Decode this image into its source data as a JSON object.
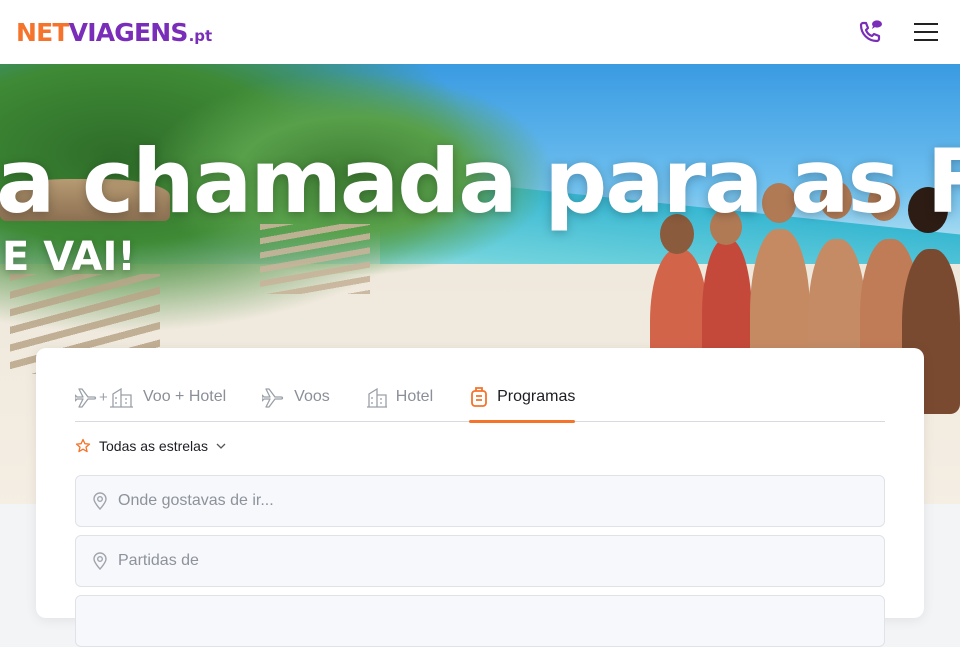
{
  "header": {
    "logo": {
      "net": "NET",
      "viagens": "VIAGENS",
      "pt": ".pt"
    },
    "icons": [
      "phone-icon",
      "menu-icon"
    ]
  },
  "hero": {
    "headline": "a chamada para as FÉ",
    "subline": "E VAI!"
  },
  "search": {
    "tabs": [
      {
        "label": "Voo + Hotel",
        "icon": "flight-hotel-icon",
        "active": false
      },
      {
        "label": "Voos",
        "icon": "plane-icon",
        "active": false
      },
      {
        "label": "Hotel",
        "icon": "hotel-icon",
        "active": false
      },
      {
        "label": "Programas",
        "icon": "luggage-icon",
        "active": true
      }
    ],
    "stars_filter": {
      "label": "Todas as estrelas",
      "icon": "star-icon"
    },
    "destination_placeholder": "Onde gostavas de ir...",
    "departure_placeholder": "Partidas de"
  },
  "colors": {
    "brand_orange": "#f5732a",
    "brand_purple": "#7a2db8",
    "tab_inactive": "#8a8f98"
  }
}
